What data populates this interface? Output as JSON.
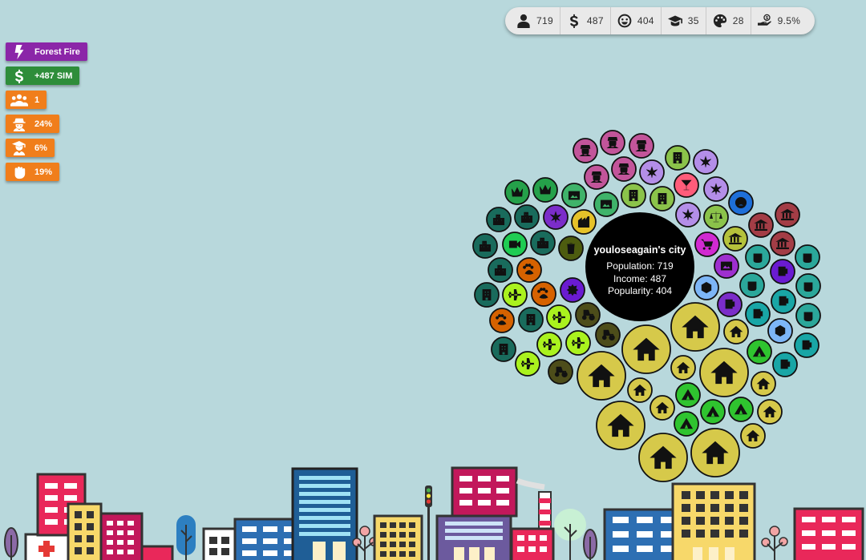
{
  "stats": [
    {
      "icon": "person-icon",
      "value": "719"
    },
    {
      "icon": "dollar-icon",
      "value": "487"
    },
    {
      "icon": "smile-icon",
      "value": "404"
    },
    {
      "icon": "graduation-cap-icon",
      "value": "35"
    },
    {
      "icon": "palette-icon",
      "value": "28"
    },
    {
      "icon": "hand-money-icon",
      "value": "9.5%"
    }
  ],
  "events": [
    {
      "label": "Forest Fire",
      "icon": "lightning-icon",
      "color": "#8b26a8"
    },
    {
      "label": "+487 SIM",
      "icon": "dollar-icon",
      "color": "#2e8d3a"
    },
    {
      "label": "1",
      "icon": "users-icon",
      "color": "#f07e1b"
    },
    {
      "label": "24%",
      "icon": "thief-icon",
      "color": "#f07e1b"
    },
    {
      "label": "6%",
      "icon": "graduate-icon",
      "color": "#f07e1b"
    },
    {
      "label": "19%",
      "icon": "fist-icon",
      "color": "#f07e1b"
    }
  ],
  "city": {
    "name": "youloseagain's city",
    "population": "Population: 719",
    "income": "Income: 487",
    "popularity": "Popularity: 404"
  },
  "colors": {
    "background": "#b8d8dc",
    "house": "#d6c94a",
    "city_center": "#000000"
  }
}
